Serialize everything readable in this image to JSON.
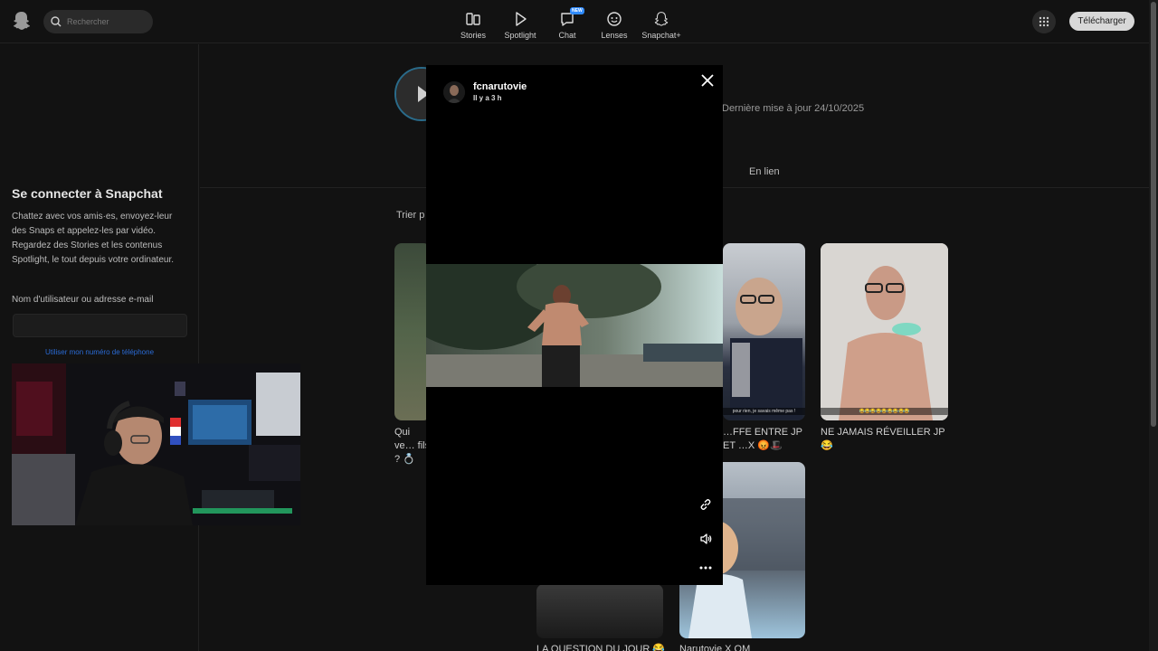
{
  "topbar": {
    "search_placeholder": "Rechercher",
    "nav": [
      {
        "label": "Stories",
        "icon": "stories-icon"
      },
      {
        "label": "Spotlight",
        "icon": "spotlight-play-icon"
      },
      {
        "label": "Chat",
        "icon": "chat-icon",
        "badge": "NEW"
      },
      {
        "label": "Lenses",
        "icon": "lenses-icon"
      },
      {
        "label": "Snapchat+",
        "icon": "snapchat-plus-icon"
      }
    ],
    "download_label": "Télécharger"
  },
  "sidebar": {
    "title": "Se connecter à Snapchat",
    "description": "Chattez avec vos amis·es, envoyez-leur des Snaps et appelez-les par vidéo. Regardez des Stories et les contenus Spotlight, le tout depuis votre ordinateur.",
    "username_label": "Nom d'utilisateur ou adresse e-mail",
    "phone_link": "Utiliser mon numéro de téléphone"
  },
  "profile": {
    "updated": "Dernière mise à jour 24/10/2025",
    "tab_linked": "En lien",
    "sort_label": "Trier p"
  },
  "cards": [
    {
      "caption": "Qui ve… fils ? 💍"
    },
    {
      "caption": "…FFE ENTRE JP ET …X 😡🎩",
      "overlay_text": "pour rien, je savais même pas !"
    },
    {
      "caption": "NE JAMAIS RÉVEILLER JP 😂",
      "overlay_text": "😂😂😂😂😂😂😂😂😂"
    },
    {
      "caption": "LA QUESTION DU JOUR 😂"
    },
    {
      "caption": "Narutovie X OM"
    }
  ],
  "viewer": {
    "username": "fcnarutovie",
    "time": "Il y a 3 h"
  },
  "colors": {
    "background": "#121212",
    "accent_blue": "#2f8bff",
    "download_button": "#d8d8d8"
  }
}
